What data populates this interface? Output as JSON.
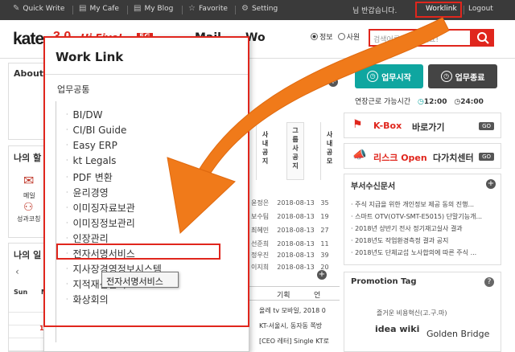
{
  "topbar": {
    "items": [
      {
        "label": "Quick Write",
        "icon": "pencil-icon"
      },
      {
        "label": "My Cafe",
        "icon": "folder-icon"
      },
      {
        "label": "My Blog",
        "icon": "folder-icon"
      },
      {
        "label": "Favorite",
        "icon": "star-icon"
      },
      {
        "label": "Setting",
        "icon": "gear-icon"
      }
    ],
    "greeting": "님 반갑습니다.",
    "worklink": "Worklink",
    "logout": "Logout"
  },
  "header": {
    "logo": "kate",
    "logo_tag": "Hi Five!",
    "logo_badge": "5G",
    "nav": [
      "Mail",
      "Wo"
    ],
    "radio": [
      "정보",
      "사원"
    ],
    "search_placeholder": "검색어를 입력하세요!"
  },
  "left": {
    "about": "About N",
    "my_section": "나의 할",
    "mail": "메일",
    "perf": "성과코칭",
    "my_schedule": "나의 일",
    "cal_days": [
      "Sun",
      "M"
    ],
    "cal_date": "13"
  },
  "middle": {
    "tabs": [
      [
        "사",
        "내",
        "공",
        "지"
      ],
      [
        "그",
        "룹",
        "사",
        "공",
        "지"
      ],
      [
        "사",
        "내",
        "공",
        "모"
      ]
    ],
    "rows": [
      {
        "name": "윤정은",
        "date": "2018-08-13",
        "num": "35"
      },
      {
        "name": "보수팀",
        "date": "2018-08-13",
        "num": "19"
      },
      {
        "name": "최혜민",
        "date": "2018-08-13",
        "num": "27"
      },
      {
        "name": "선준희",
        "date": "2018-08-13",
        "num": "11"
      },
      {
        "name": "정우진",
        "date": "2018-08-13",
        "num": "39"
      },
      {
        "name": "이지희",
        "date": "2018-08-13",
        "num": "20"
      }
    ],
    "tab2": [
      "기획",
      "언"
    ],
    "news": [
      "올레 tv 모바일, 2018 0",
      "KT-서울시, 동자동 쪽방",
      "[CEO 레터] Single KT로"
    ]
  },
  "right": {
    "start_btn": "업무시작",
    "end_btn": "업무종료",
    "time_label": "연장근로 가능시간",
    "time1": "12:00",
    "time2": "24:00",
    "kbox_title": "K-Box",
    "kbox_suffix": "바로가기",
    "risk_title": "리스크 Open",
    "risk_suffix": "다가치센터",
    "go": "GO",
    "sub_title": "부서수신문서",
    "sub_items": [
      "주식 지급을 위한 개인정보 제공 동의 진행...",
      "스마트 OTV(OTV-SMT-E5015) 단말기능개...",
      "2018년 상반기 전사 정기재고실사 결과",
      "2018년도 작업환경측정 결과 공지",
      "2018년도 단체교섭 노사합의에 따른 주식 ..."
    ],
    "promo_title": "Promotion Tag",
    "promo_sub": "즐거운 비용혁신(고.구.마)",
    "promo_a": "idea wiki",
    "promo_b": "Golden Bridge"
  },
  "popup": {
    "title": "Work Link",
    "section": "업무공통",
    "items": [
      "BI/DW",
      "CI/BI Guide",
      "Easy ERP",
      "kt Legals",
      "PDF 변환",
      "윤리경영",
      "이미징자료보관",
      "이미징정보관리",
      "인장관리",
      "전자서명서비스",
      "지사장경영정보시스템",
      "지적재산관리",
      "화상회의"
    ],
    "tooltip": "전자서명서비스"
  },
  "colors": {
    "accent_red": "#e0261d",
    "arrow_orange": "#f07a1a",
    "teal": "#0fa6a0"
  }
}
